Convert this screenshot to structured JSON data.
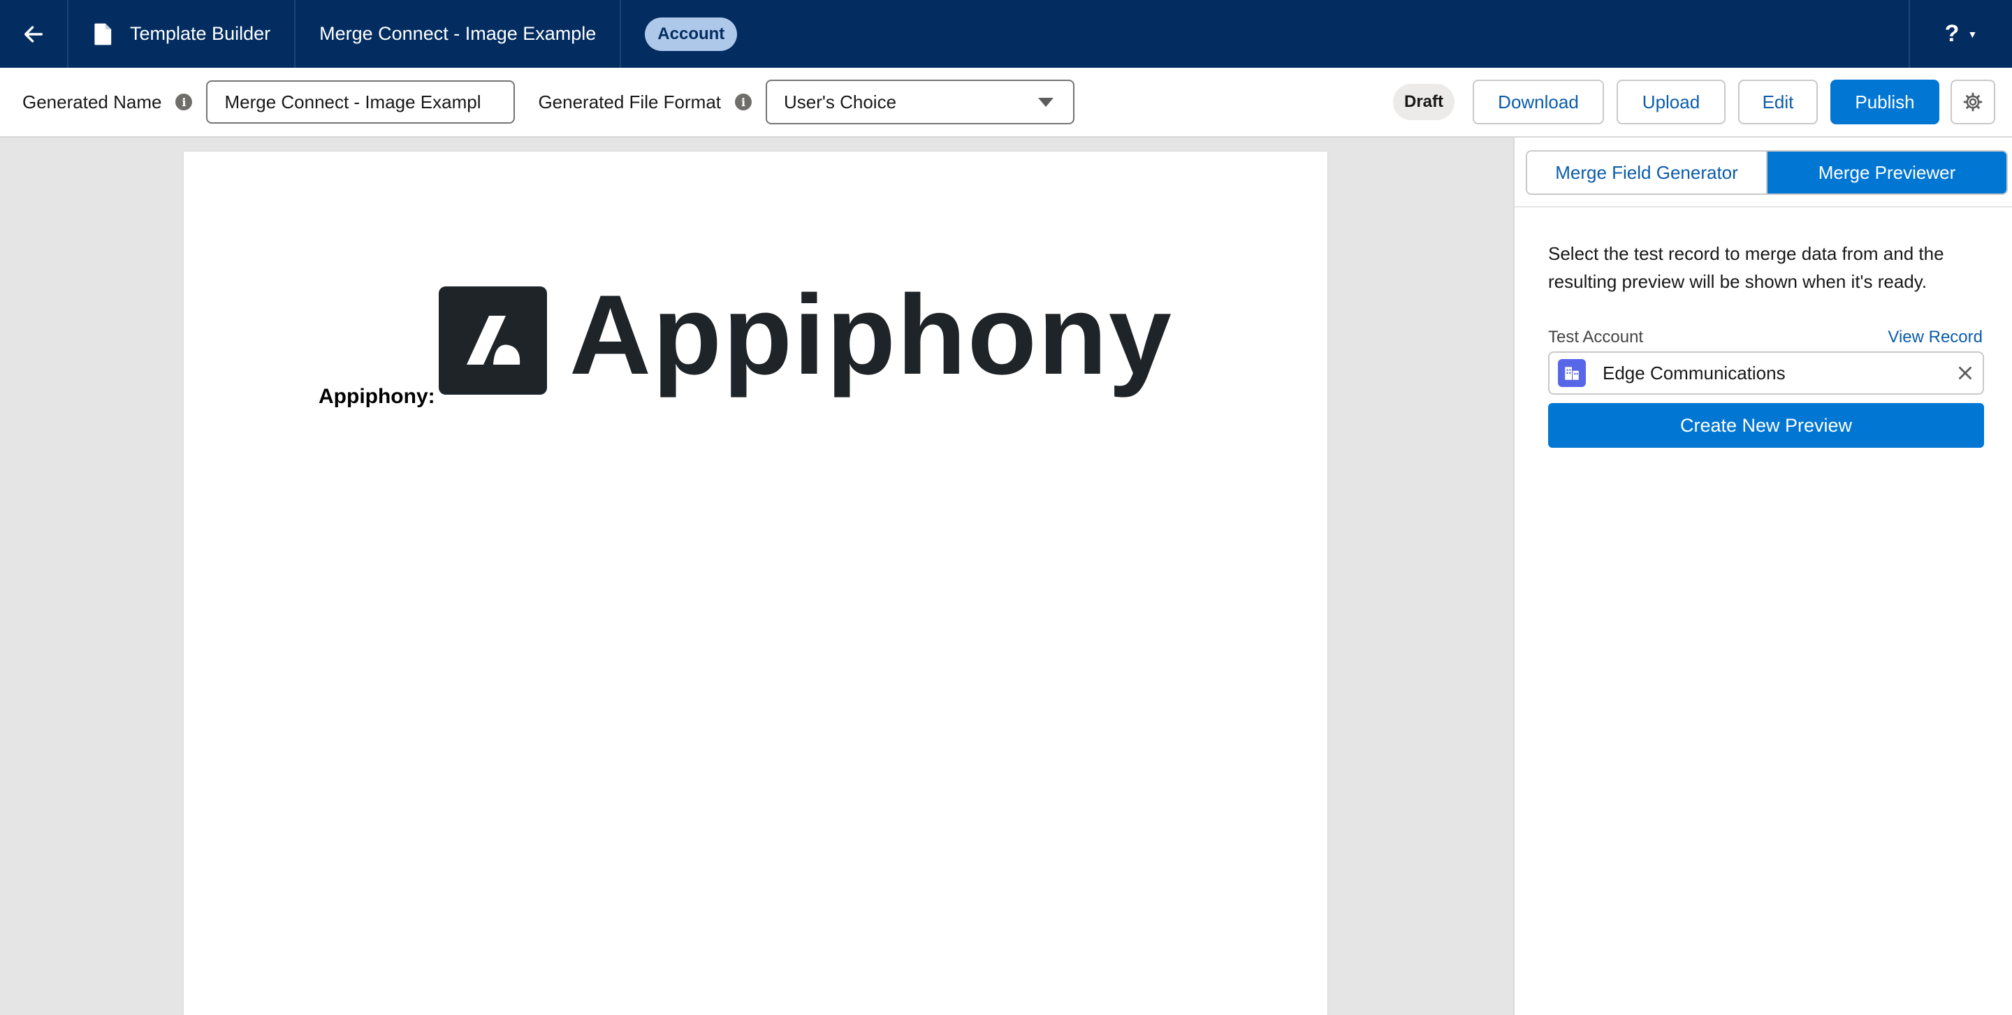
{
  "header": {
    "back_icon": "arrow-left-icon",
    "builder_icon": "document-icon",
    "builder_label": "Template Builder",
    "template_title": "Merge Connect - Image Example",
    "object_badge": "Account",
    "help_label": "?",
    "help_icon": "caret-down-icon",
    "background_color": "#032d60"
  },
  "toolbar": {
    "generated_name_label": "Generated Name",
    "generated_name_value": "Merge Connect - Image Exampl",
    "file_format_label": "Generated File Format",
    "file_format_value": "User's Choice",
    "status_badge": "Draft",
    "download_label": "Download",
    "upload_label": "Upload",
    "edit_label": "Edit",
    "publish_label": "Publish",
    "settings_icon": "gear-icon",
    "brand_color": "#0176d3"
  },
  "document": {
    "field_label": "Appiphony:",
    "logo_text": "Appiphony"
  },
  "panel": {
    "tabs": [
      {
        "label": "Merge Field Generator",
        "active": false
      },
      {
        "label": "Merge Previewer",
        "active": true
      }
    ],
    "description": "Select the test record to merge data from and the resulting preview will be shown when it's ready.",
    "test_record_label": "Test Account",
    "view_record_link": "View Record",
    "selected_record": "Edge Communications",
    "record_icon": "account-icon",
    "clear_icon": "close-icon",
    "create_preview_label": "Create New Preview"
  }
}
